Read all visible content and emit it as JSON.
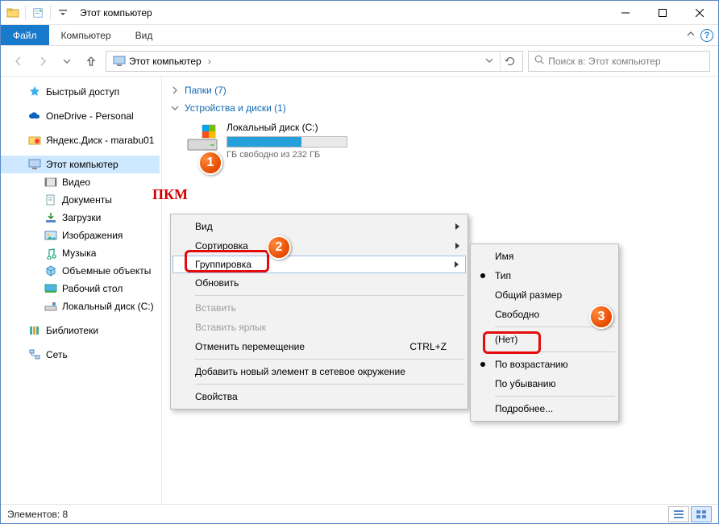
{
  "window": {
    "title": "Этот компьютер"
  },
  "ribbon": {
    "file": "Файл",
    "computer": "Компьютер",
    "view": "Вид"
  },
  "address": {
    "location": "Этот компьютер"
  },
  "search": {
    "placeholder": "Поиск в: Этот компьютер"
  },
  "sidebar": {
    "quick": "Быстрый доступ",
    "onedrive": "OneDrive - Personal",
    "yadisk": "Яндекс.Диск - marabu01",
    "thispc": "Этот компьютер",
    "videos": "Видео",
    "documents": "Документы",
    "downloads": "Загрузки",
    "pictures": "Изображения",
    "music": "Музыка",
    "objects3d": "Объемные объекты",
    "desktop": "Рабочий стол",
    "drive_c": "Локальный диск (C:)",
    "libraries": "Библиотеки",
    "network": "Сеть"
  },
  "groups": {
    "folders": "Папки (7)",
    "devices": "Устройства и диски (1)"
  },
  "drive": {
    "name": "Локальный диск (C:)",
    "free_line": "ГБ свободно из 232 ГБ",
    "fill_percent": 62
  },
  "ctx1": {
    "view": "Вид",
    "sort": "Сортировка",
    "group": "Группировка",
    "refresh": "Обновить",
    "paste": "Вставить",
    "paste_short": "Вставить ярлык",
    "undo_move": "Отменить перемещение",
    "undo_kbd": "CTRL+Z",
    "add_net": "Добавить новый элемент в сетевое окружение",
    "properties": "Свойства"
  },
  "ctx2": {
    "name": "Имя",
    "type": "Тип",
    "size": "Общий размер",
    "free": "Свободно",
    "none": "(Нет)",
    "asc": "По возрастанию",
    "desc": "По убыванию",
    "more": "Подробнее..."
  },
  "annot": {
    "pkm": "ПКМ",
    "b1": "1",
    "b2": "2",
    "b3": "3"
  },
  "status": {
    "items": "Элементов: 8"
  }
}
